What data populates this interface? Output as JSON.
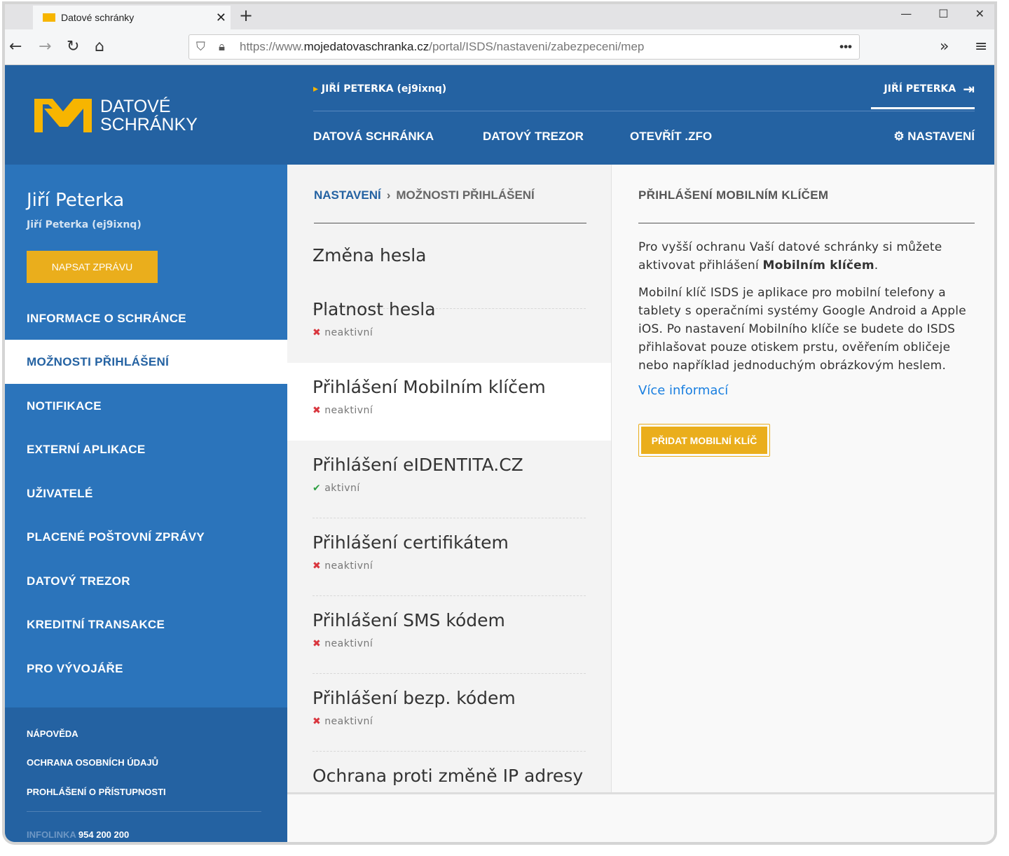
{
  "browser": {
    "tab_title": "Datové schránky",
    "url_prefix": "https://www.",
    "url_domain": "mojedatovaschranka.cz",
    "url_path": "/portal/ISDS/nastaveni/zabezpeceni/mep",
    "more": "•••"
  },
  "header": {
    "logo_line1": "DATOVÉ",
    "logo_line2": "SCHRÁNKY",
    "user": "JIŘÍ PETERKA (ej9ixnq)",
    "logout_user": "JIŘÍ PETERKA",
    "nav": [
      "DATOVÁ SCHRÁNKA",
      "DATOVÝ TREZOR",
      "OTEVŘÍT .ZFO",
      "NASTAVENÍ"
    ]
  },
  "sidebar": {
    "name": "Jiří Peterka",
    "sub": "Jiří Peterka (ej9ixnq)",
    "write_button": "NAPSAT ZPRÁVU",
    "items": [
      "INFORMACE O SCHRÁNCE",
      "MOŽNOSTI PŘIHLÁŠENÍ",
      "NOTIFIKACE",
      "EXTERNÍ APLIKACE",
      "UŽIVATELÉ",
      "PLACENÉ POŠTOVNÍ ZPRÁVY",
      "DATOVÝ TREZOR",
      "KREDITNÍ TRANSAKCE",
      "PRO VÝVOJÁŘE"
    ],
    "footer": [
      "NÁPOVĚDA",
      "OCHRANA OSOBNÍCH ÚDAJŮ",
      "PROHLÁŠENÍ O PŘÍSTUPNOSTI"
    ],
    "infolinka_label": "INFOLINKA",
    "infolinka_number": "954 200 200"
  },
  "breadcrumb": {
    "parent": "NASTAVENÍ",
    "current": "MOŽNOSTI PŘIHLÁŠENÍ"
  },
  "options": [
    {
      "title": "Změna hesla",
      "status": ""
    },
    {
      "title": "Platnost hesla",
      "status": "neaktivní"
    },
    {
      "title": "Přihlášení Mobilním klíčem",
      "status": "neaktivní"
    },
    {
      "title": "Přihlášení eIDENTITA.CZ",
      "status": "aktivní"
    },
    {
      "title": "Přihlášení certifikátem",
      "status": "neaktivní"
    },
    {
      "title": "Přihlášení SMS kódem",
      "status": "neaktivní"
    },
    {
      "title": "Přihlášení bezp. kódem",
      "status": "neaktivní"
    },
    {
      "title": "Ochrana proti změně IP adresy",
      "status": ""
    }
  ],
  "detail": {
    "heading": "PŘIHLÁŠENÍ MOBILNÍM KLÍČEM",
    "p1_pre": "Pro vyšší ochranu Vaší datové schránky si můžete aktivovat přihlášení ",
    "p1_bold": "Mobilním klíčem",
    "p1_post": ".",
    "p2": "Mobilní klíč ISDS je aplikace pro mobilní telefony a tablety s operačními systémy Google Android a Apple iOS. Po nastavení Mobilního klíče se budete do ISDS přihlašovat pouze otiskem prstu, ověřením obličeje nebo například jednoduchým obrázkovým heslem.",
    "more_link": "Více informací",
    "add_button": "PŘIDAT MOBILNÍ KLÍČ"
  }
}
